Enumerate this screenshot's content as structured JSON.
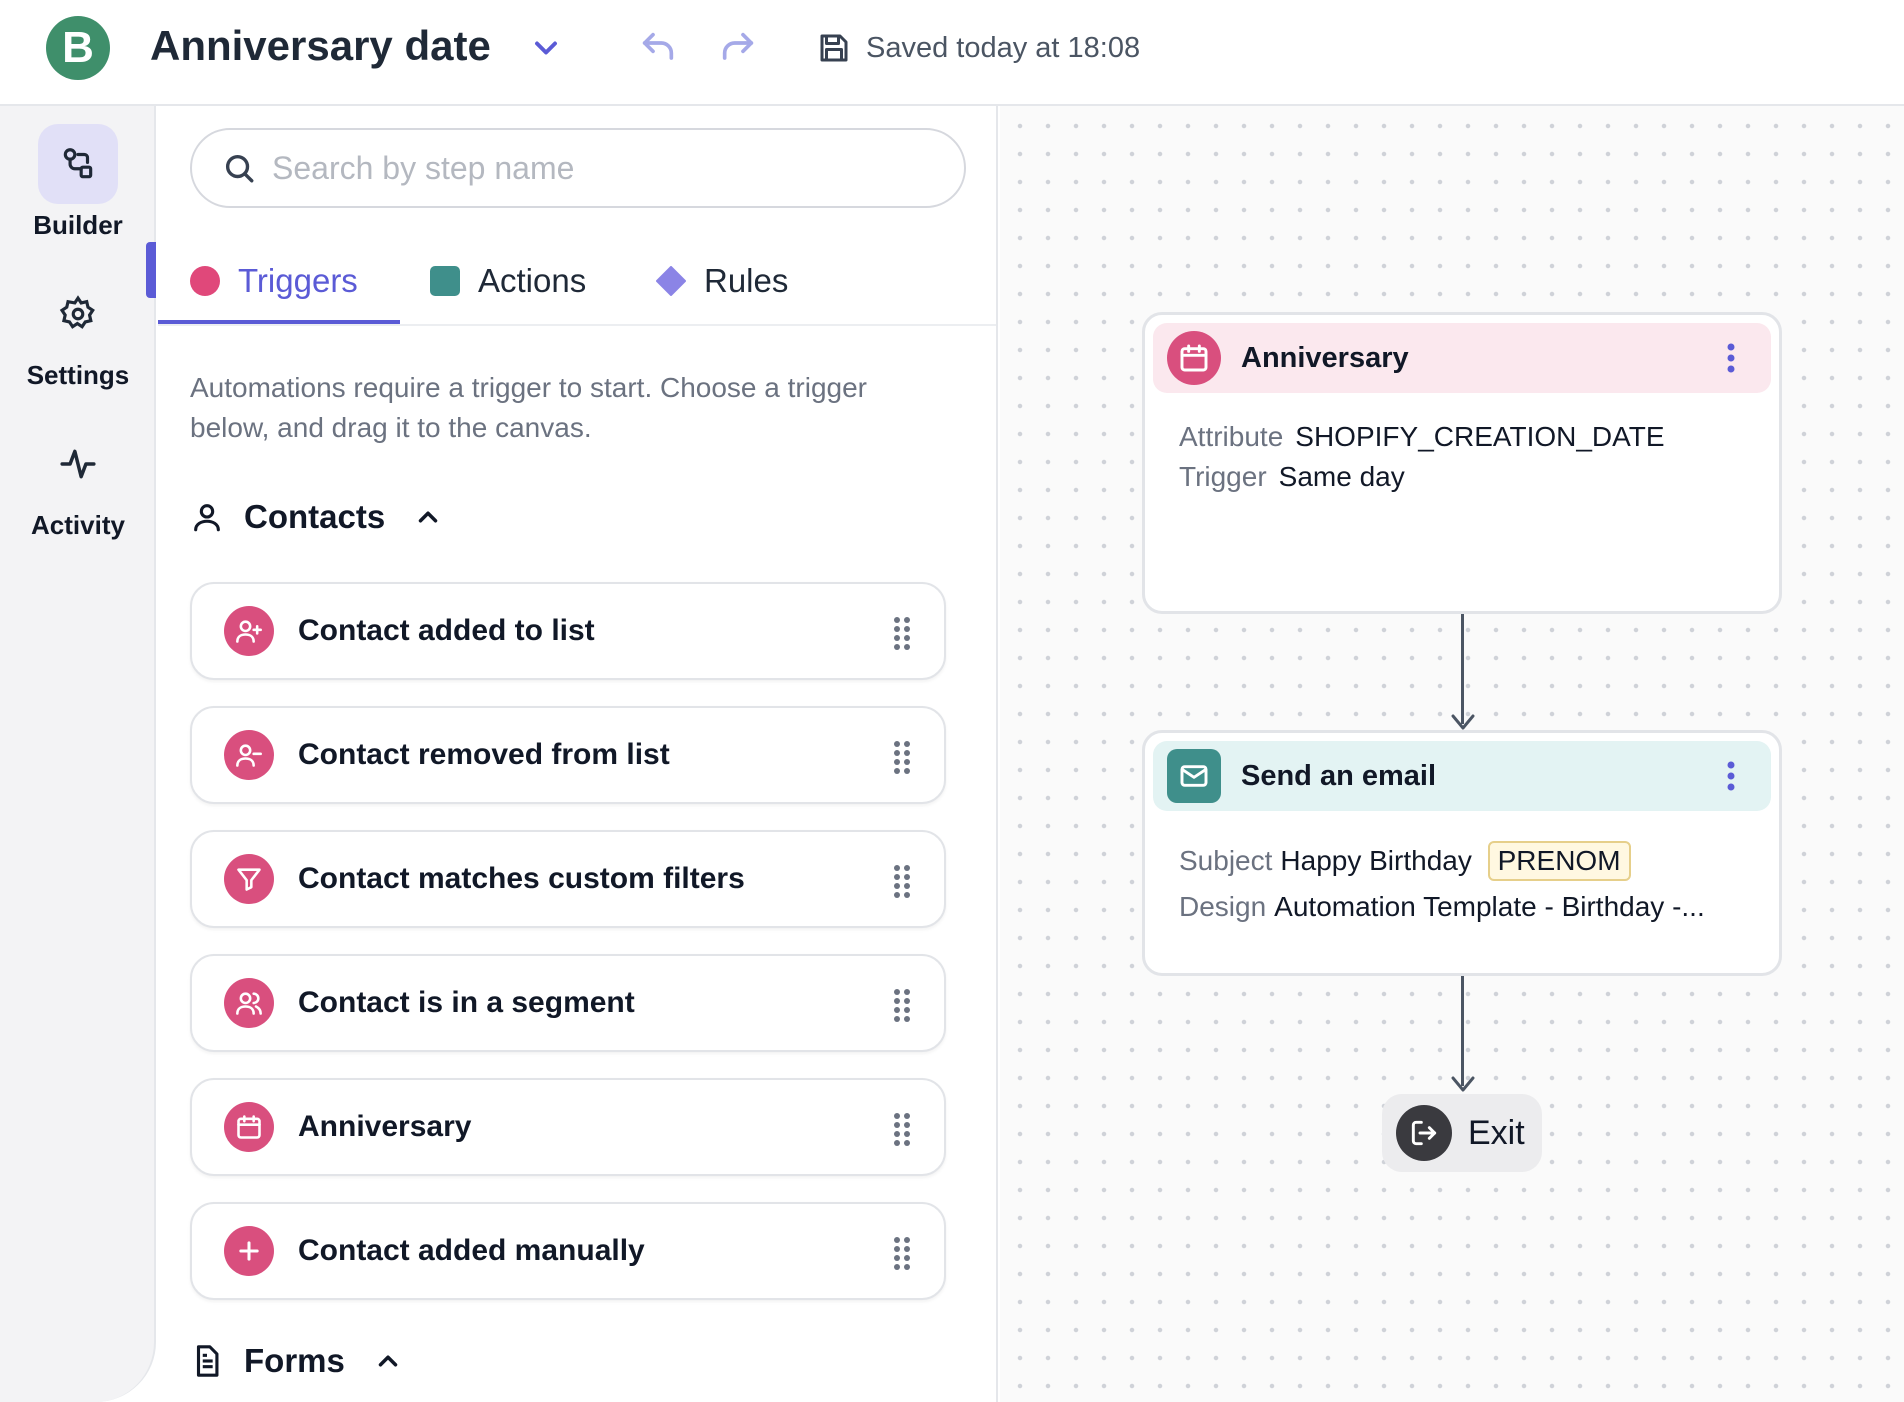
{
  "header": {
    "logo_letter": "B",
    "title": "Anniversary date",
    "saved_status": "Saved today at 18:08"
  },
  "rail": {
    "items": [
      {
        "label": "Builder",
        "icon": "builder-icon",
        "active": true
      },
      {
        "label": "Settings",
        "icon": "gear-icon",
        "active": false
      },
      {
        "label": "Activity",
        "icon": "activity-icon",
        "active": false
      }
    ]
  },
  "panel": {
    "search_placeholder": "Search by step name",
    "tabs": [
      {
        "label": "Triggers",
        "color": "#e0487a",
        "shape": "circle",
        "active": true
      },
      {
        "label": "Actions",
        "color": "#3f8f8b",
        "shape": "square",
        "active": false
      },
      {
        "label": "Rules",
        "color": "#8b84e6",
        "shape": "diamond",
        "active": false
      }
    ],
    "help_text": "Automations require a trigger to start. Choose a trigger below, and drag it to the canvas.",
    "sections": [
      {
        "label": "Contacts",
        "icon": "user-icon",
        "expanded": true
      },
      {
        "label": "Forms",
        "icon": "document-icon",
        "expanded": true
      }
    ],
    "triggers": [
      {
        "label": "Contact added to list",
        "icon": "user-plus-icon"
      },
      {
        "label": "Contact removed from list",
        "icon": "user-minus-icon"
      },
      {
        "label": "Contact matches custom filters",
        "icon": "filter-icon"
      },
      {
        "label": "Contact is in a segment",
        "icon": "users-icon"
      },
      {
        "label": "Anniversary",
        "icon": "calendar-icon"
      },
      {
        "label": "Contact added manually",
        "icon": "plus-icon"
      }
    ]
  },
  "canvas": {
    "trigger_node": {
      "title": "Anniversary",
      "icon": "calendar-icon",
      "header_color": "#fbe8ee",
      "icon_color": "#d94f7e",
      "rows": [
        {
          "key": "Attribute",
          "value": "SHOPIFY_CREATION_DATE"
        },
        {
          "key": "Trigger",
          "value": "Same day"
        }
      ]
    },
    "action_node": {
      "title": "Send an email",
      "icon": "mail-icon",
      "header_color": "#e3f3f3",
      "icon_color": "#3f8f8b",
      "subject_key": "Subject",
      "subject_value": "Happy Birthday",
      "subject_tag": "PRENOM",
      "design_key": "Design",
      "design_value": "Automation Template - Birthday -..."
    },
    "exit_label": "Exit"
  },
  "colors": {
    "accent": "#5b5bd6",
    "trigger_pink": "#d94f7e",
    "action_teal": "#3f8f8b",
    "brand_green": "#3f8f6b"
  }
}
